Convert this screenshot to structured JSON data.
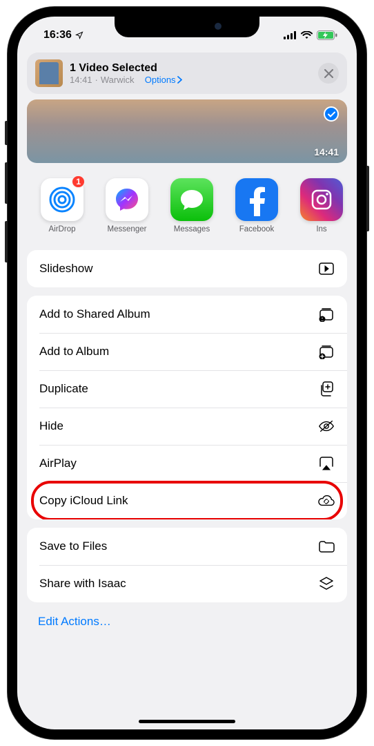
{
  "status_bar": {
    "time": "16:36"
  },
  "header": {
    "title": "1 Video Selected",
    "duration": "14:41",
    "separator": " · ",
    "location": "Warwick",
    "options_label": "Options"
  },
  "preview": {
    "duration": "14:41"
  },
  "apps": [
    {
      "name": "AirDrop",
      "badge": "1",
      "icon": "airdrop"
    },
    {
      "name": "Messenger",
      "badge": null,
      "icon": "messenger"
    },
    {
      "name": "Messages",
      "badge": null,
      "icon": "messages"
    },
    {
      "name": "Facebook",
      "badge": null,
      "icon": "facebook"
    },
    {
      "name": "Ins",
      "badge": null,
      "icon": "instagram"
    }
  ],
  "group1": [
    {
      "label": "Slideshow",
      "icon": "play"
    }
  ],
  "group2": [
    {
      "label": "Add to Shared Album",
      "icon": "shared-album"
    },
    {
      "label": "Add to Album",
      "icon": "add-album"
    },
    {
      "label": "Duplicate",
      "icon": "duplicate"
    },
    {
      "label": "Hide",
      "icon": "hide"
    },
    {
      "label": "AirPlay",
      "icon": "airplay"
    },
    {
      "label": "Copy iCloud Link",
      "icon": "cloud-link",
      "highlighted": true
    }
  ],
  "group3": [
    {
      "label": "Save to Files",
      "icon": "folder"
    },
    {
      "label": "Share with Isaac",
      "icon": "stack"
    }
  ],
  "footer": {
    "edit_actions": "Edit Actions…"
  }
}
